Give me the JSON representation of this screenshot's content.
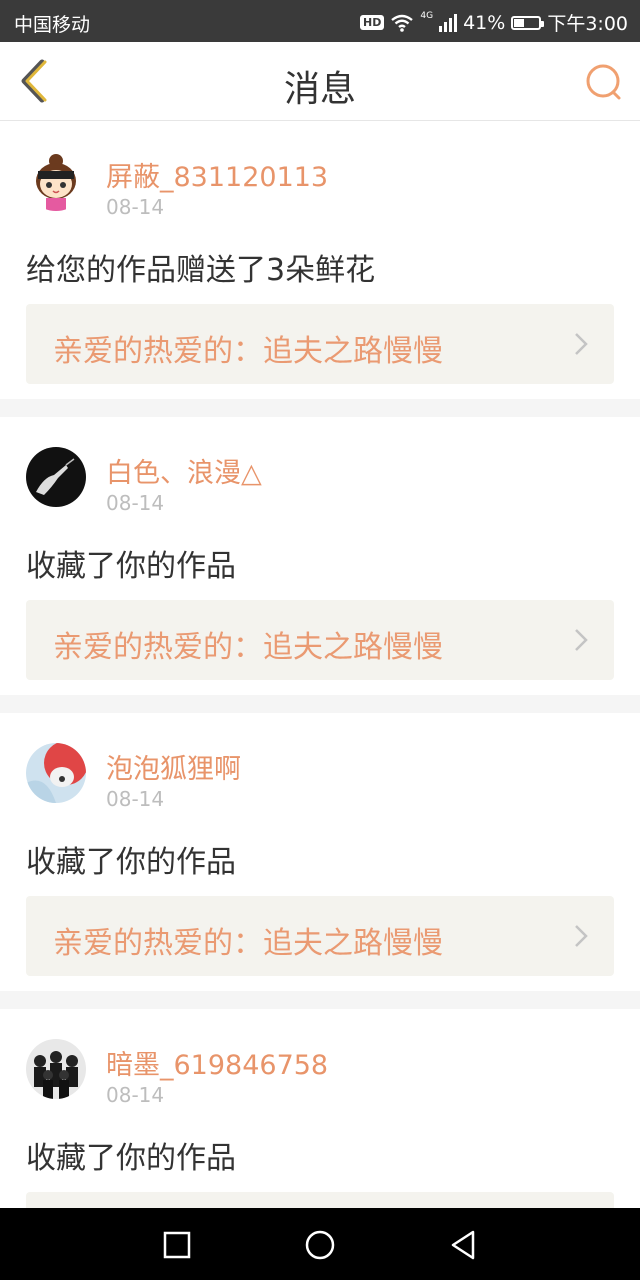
{
  "status_bar": {
    "carrier": "中国移动",
    "hd": "HD",
    "network": "4G",
    "battery_text": "41%",
    "battery_level": 0.41,
    "time": "下午3:00"
  },
  "header": {
    "title": "消息",
    "back_icon": "chevron-left-icon",
    "search_icon": "search-icon"
  },
  "colors": {
    "accent": "#e8946a",
    "back_icon": "#e0b73a",
    "search_icon": "#f0a070",
    "work_bg": "#f4f3ee"
  },
  "messages": [
    {
      "username": "屏蔽_831120113",
      "date": "08-14",
      "action": "给您的作品赠送了3朵鲜花",
      "work_title": "亲爱的热爱的：追夫之路慢慢"
    },
    {
      "username": "白色、浪漫△",
      "date": "08-14",
      "action": "收藏了你的作品",
      "work_title": "亲爱的热爱的：追夫之路慢慢"
    },
    {
      "username": "泡泡狐狸啊",
      "date": "08-14",
      "action": "收藏了你的作品",
      "work_title": "亲爱的热爱的：追夫之路慢慢"
    },
    {
      "username": "暗墨_619846758",
      "date": "08-14",
      "action": "收藏了你的作品",
      "work_title": ""
    }
  ],
  "nav_bar": {
    "recent_icon": "square-icon",
    "home_icon": "circle-icon",
    "back_icon": "triangle-back-icon"
  }
}
